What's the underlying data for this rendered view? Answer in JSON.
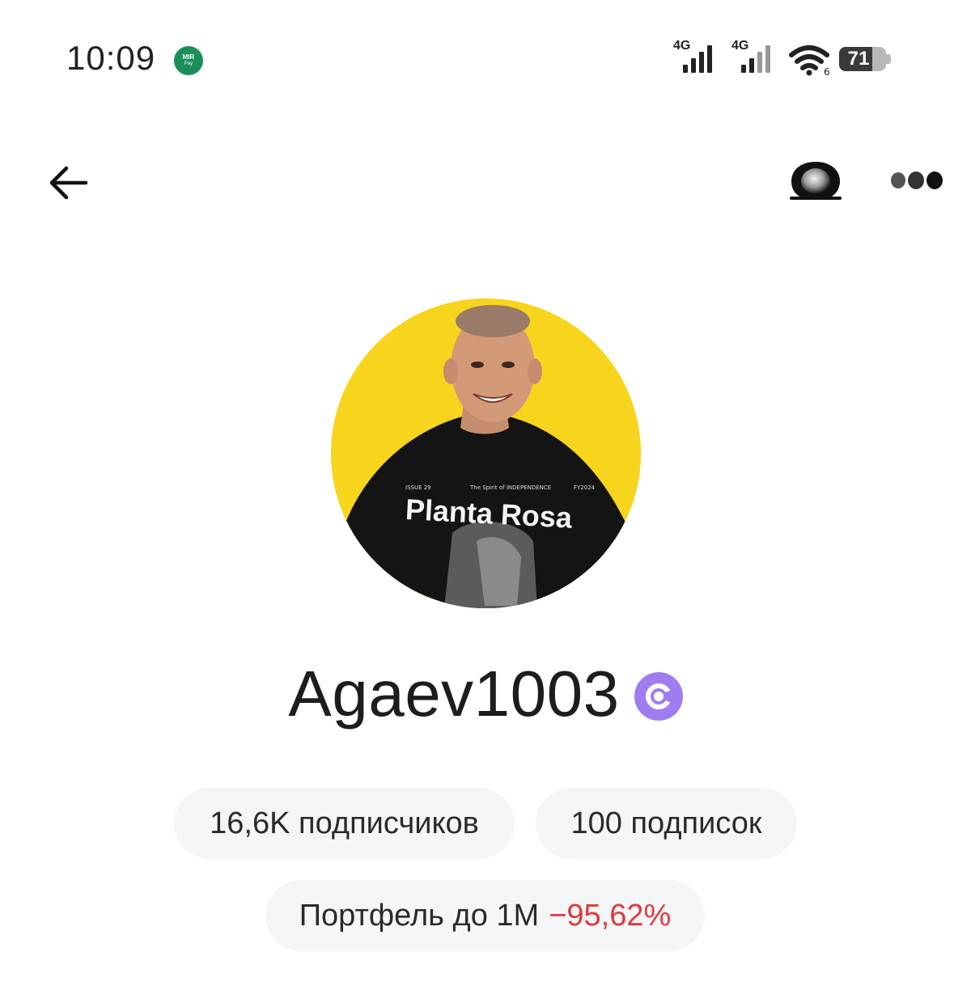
{
  "status_bar": {
    "time": "10:09",
    "mirpay_line1": "MIR",
    "mirpay_line2": "Pay",
    "network1": "4G",
    "network2": "4G",
    "wifi_badge": "6",
    "battery_percent": "71",
    "battery_level": 0.71
  },
  "header": {
    "back_icon": "arrow-left-icon",
    "chat_icon": "chat-bubble-icon",
    "more_icon": "more-dots-icon"
  },
  "profile": {
    "username": "Agaev1003",
    "badge_icon": "verified-c-icon",
    "badge_color": "#9f7df0",
    "avatar_bg": "#f7d51d",
    "shirt_text": "Planta Rosa"
  },
  "stats": {
    "followers": "16,6K подписчиков",
    "following": "100 подписок"
  },
  "portfolio": {
    "label": "Портфель до 1М",
    "change": "−95,62%",
    "change_color": "#e0393e"
  }
}
